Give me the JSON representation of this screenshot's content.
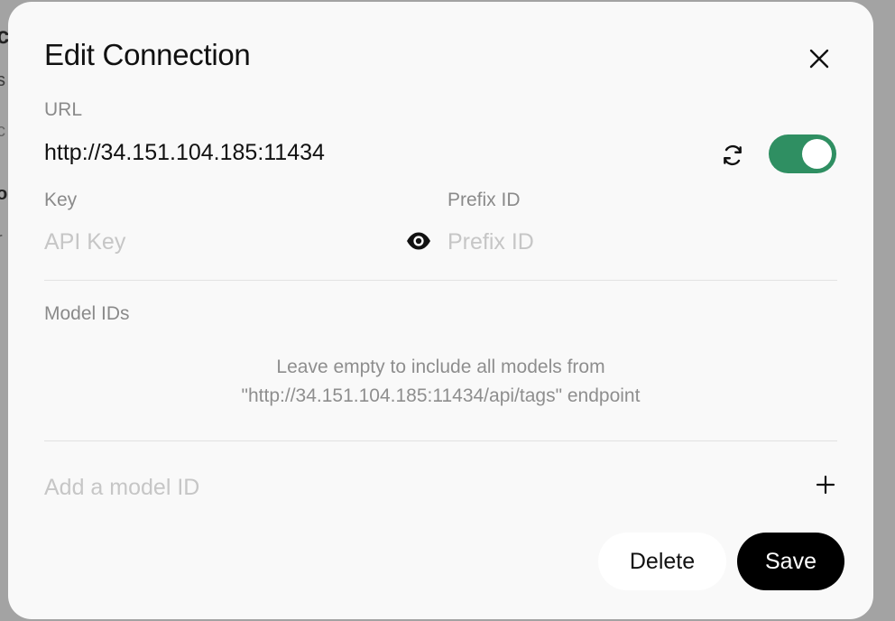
{
  "dialog": {
    "title": "Edit Connection"
  },
  "url_field": {
    "label": "URL",
    "value": "http://34.151.104.185:11434",
    "enabled": true
  },
  "key_field": {
    "label": "Key",
    "placeholder": "API Key",
    "value": ""
  },
  "prefix_field": {
    "label": "Prefix ID",
    "placeholder": "Prefix ID",
    "value": ""
  },
  "model_ids": {
    "label": "Model IDs",
    "help_line1": "Leave empty to include all models from",
    "help_line2": "\"http://34.151.104.185:11434/api/tags\" endpoint",
    "add_placeholder": "Add a model ID"
  },
  "actions": {
    "delete_label": "Delete",
    "save_label": "Save"
  },
  "icons": {
    "close": "close-icon",
    "refresh": "refresh-icon",
    "eye": "eye-icon",
    "plus": "plus-icon"
  },
  "colors": {
    "toggle_on": "#2f8f62",
    "save_bg": "#000000",
    "modal_bg": "#f9f9f9"
  }
}
